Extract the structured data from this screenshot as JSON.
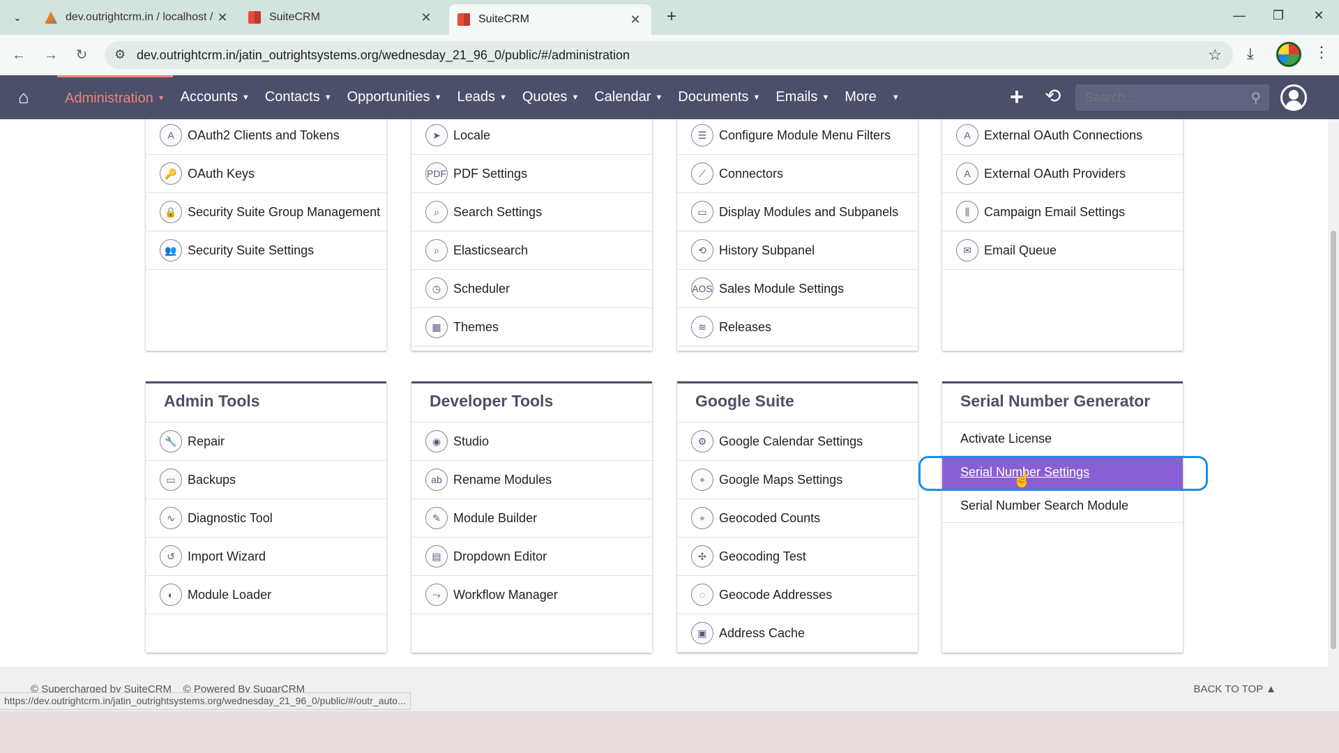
{
  "browser": {
    "tabs": [
      {
        "title": "dev.outrightcrm.in / localhost /",
        "close": "✕"
      },
      {
        "title": "SuiteCRM",
        "close": "✕"
      },
      {
        "title": "SuiteCRM",
        "close": "✕"
      }
    ],
    "new_tab": "+",
    "url": "dev.outrightcrm.in/jatin_outrightsystems.org/wednesday_21_96_0/public/#/administration"
  },
  "crm_nav": {
    "items": [
      {
        "label": "Administration",
        "active": true
      },
      {
        "label": "Accounts"
      },
      {
        "label": "Contacts"
      },
      {
        "label": "Opportunities"
      },
      {
        "label": "Leads"
      },
      {
        "label": "Quotes"
      },
      {
        "label": "Calendar"
      },
      {
        "label": "Documents"
      },
      {
        "label": "Emails"
      },
      {
        "label": "More"
      }
    ],
    "search_placeholder": "Search..."
  },
  "top_panels": [
    {
      "items": [
        "OAuth2 Clients and Tokens",
        "OAuth Keys",
        "Security Suite Group Management",
        "Security Suite Settings"
      ]
    },
    {
      "items": [
        "Locale",
        "PDF Settings",
        "Search Settings",
        "Elasticsearch",
        "Scheduler",
        "Themes"
      ]
    },
    {
      "items": [
        "Configure Module Menu Filters",
        "Connectors",
        "Display Modules and Subpanels",
        "History Subpanel",
        "Sales Module Settings",
        "Releases"
      ]
    },
    {
      "items": [
        "External OAuth Connections",
        "External OAuth Providers",
        "Campaign Email Settings",
        "Email Queue"
      ]
    }
  ],
  "bottom_panels": [
    {
      "title": "Admin Tools",
      "items": [
        "Repair",
        "Backups",
        "Diagnostic Tool",
        "Import Wizard",
        "Module Loader"
      ]
    },
    {
      "title": "Developer Tools",
      "items": [
        "Studio",
        "Rename Modules",
        "Module Builder",
        "Dropdown Editor",
        "Workflow Manager"
      ]
    },
    {
      "title": "Google Suite",
      "items": [
        "Google Calendar Settings",
        "Google Maps Settings",
        "Geocoded Counts",
        "Geocoding Test",
        "Geocode Addresses",
        "Address Cache"
      ]
    },
    {
      "title": "Serial Number Generator",
      "items": [
        "Activate License",
        "Serial Number Settings",
        "Serial Number Search Module"
      ],
      "selected": "Serial Number Settings"
    }
  ],
  "footer": {
    "left": "© Supercharged by SuiteCRM    © Powered By SugarCRM",
    "back_to_top": "BACK TO TOP"
  },
  "status_url": "https://dev.outrightcrm.in/jatin_outrightsystems.org/wednesday_21_96_0/public/#/outr_auto..."
}
